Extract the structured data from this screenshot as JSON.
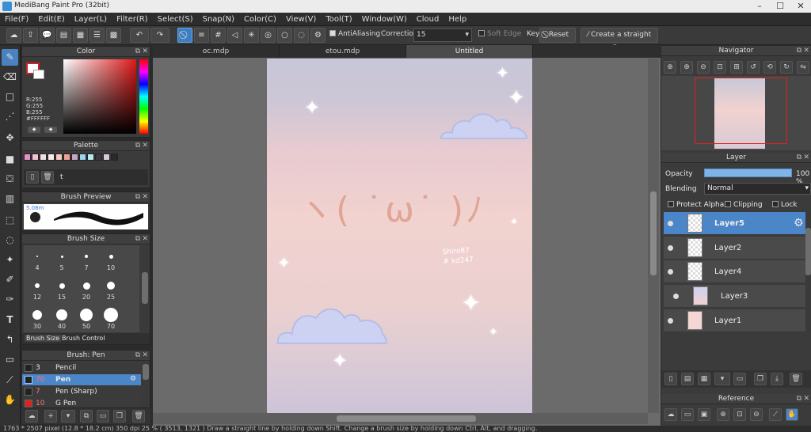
{
  "app": {
    "title": "MediBang Paint Pro (32bit)"
  },
  "menu": [
    "File(F)",
    "Edit(E)",
    "Layer(L)",
    "Filter(R)",
    "Select(S)",
    "Snap(N)",
    "Color(C)",
    "View(V)",
    "Tool(T)",
    "Window(W)",
    "Cloud",
    "Help"
  ],
  "toolbar": {
    "antialiasing_label": "AntiAliasing",
    "correction_label": "Correction",
    "correction_value": "15",
    "soft_edge_label": "Soft Edge",
    "key_label": "Key",
    "reset_label": "Reset",
    "hint_label": "Create a straight line"
  },
  "color_panel": {
    "title": "Color",
    "r": "R:255",
    "g": "G:255",
    "b": "B:255",
    "hex": "#FFFFFF"
  },
  "palette_panel": {
    "title": "Palette",
    "name": "t",
    "swatches": [
      "#e88ec8",
      "#f2c2d8",
      "#f7dbe4",
      "#fde8ea",
      "#f6c8c0",
      "#ee9f9a",
      "#c6a6c8",
      "#9ad4e8",
      "#b8e8f0",
      "#3a3a3a",
      "#d8c8d8",
      "#2a2a2a"
    ]
  },
  "brush_preview": {
    "title": "Brush Preview",
    "size": "5.08m"
  },
  "brush_size": {
    "title": "Brush Size",
    "sizes": [
      "4",
      "5",
      "7",
      "10",
      "12",
      "15",
      "20",
      "25",
      "30",
      "40",
      "50",
      "70"
    ],
    "tabs": [
      "Brush Size",
      "Brush Control"
    ]
  },
  "brush_panel": {
    "title": "Brush: Pen",
    "items": [
      {
        "size": "3",
        "name": "Pencil"
      },
      {
        "size": "70",
        "name": "Pen"
      },
      {
        "size": "7",
        "name": "Pen (Sharp)"
      },
      {
        "size": "10",
        "name": "G Pen"
      }
    ]
  },
  "tabs": [
    "oc.mdp",
    "etou.mdp",
    "Untitled"
  ],
  "artwork": {
    "face": "ヽ( ˙ω˙ )ﾉ",
    "signature_line1": "Shiro87",
    "signature_line2": "# kd247"
  },
  "navigator": {
    "title": "Navigator"
  },
  "layer_panel": {
    "title": "Layer",
    "opacity_label": "Opacity",
    "opacity_value": "100 %",
    "blending_label": "Blending",
    "blending_value": "Normal",
    "protect_alpha": "Protect Alpha",
    "clipping": "Clipping",
    "lock": "Lock",
    "layers": [
      "Layer5",
      "Layer2",
      "Layer4",
      "Layer3",
      "Layer1"
    ]
  },
  "reference": {
    "title": "Reference"
  },
  "status": "1763 * 2507 pixel  (12.8 * 18.2 cm)  350 dpi  25 %  ( 3513, 1321 )  Draw a straight line by holding down Shift. Change a brush size by holding down Ctrl, Alt, and dragging."
}
